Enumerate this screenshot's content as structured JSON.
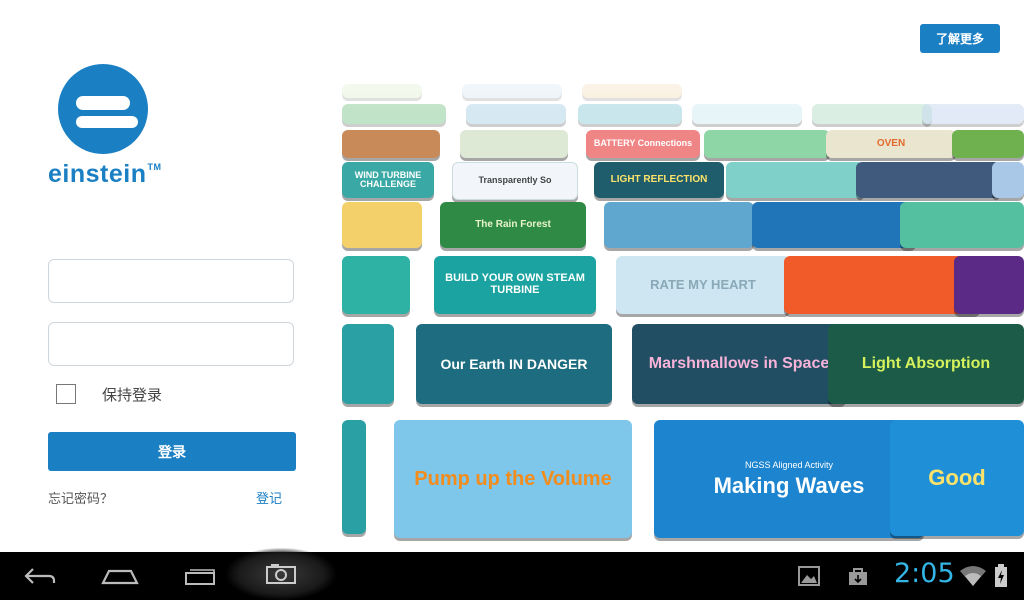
{
  "brand": {
    "name": "einstein",
    "tm": "TM"
  },
  "header": {
    "learn_more": "了解更多"
  },
  "login": {
    "username": {
      "value": "",
      "placeholder": ""
    },
    "password": {
      "value": "",
      "placeholder": ""
    },
    "remember_label": "保持登录",
    "remember_checked": false,
    "login_button": "登录",
    "forgot_password": "忘记密码？",
    "register": "登记"
  },
  "activities": {
    "tiles": [
      "WIND TURBINE CHALLENGE",
      "Transparently So",
      "BATTERY Connections",
      "OVEN",
      "LIGHT REFLECTION",
      "The Rain Forest",
      "BUILD YOUR OWN STEAM TURBINE",
      "RATE MY HEART",
      "Our Earth IN DANGER",
      "Marshmallows in Space",
      "Light Absorption",
      "Pump up the Volume",
      "NGSS Aligned Activity",
      "Making Waves",
      "Good"
    ]
  },
  "system_bar": {
    "time": "2:05",
    "icons": [
      "back-icon",
      "home-icon",
      "recent-apps-icon",
      "screenshot-icon",
      "gallery-icon",
      "bag-icon",
      "wifi-icon",
      "battery-charging-icon"
    ]
  },
  "colors": {
    "accent": "#1b7fc4",
    "clock": "#33b5e5",
    "navbar": "#000000"
  }
}
